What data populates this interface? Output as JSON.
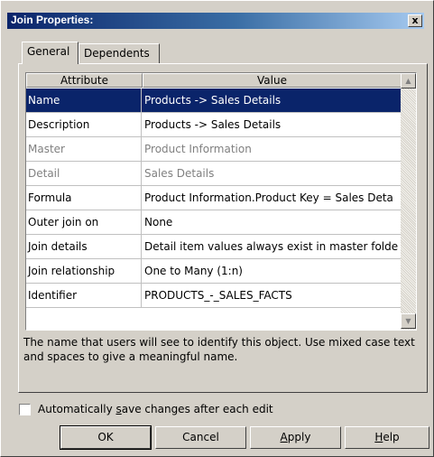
{
  "dialog": {
    "title": "Join Properties:",
    "close_glyph": "x"
  },
  "tabs": [
    {
      "label": "General",
      "active": true
    },
    {
      "label": "Dependents",
      "active": false
    }
  ],
  "grid": {
    "columns": [
      "Attribute",
      "Value"
    ],
    "rows": [
      {
        "attribute": "Name",
        "value": "Products -> Sales Details",
        "state": "selected"
      },
      {
        "attribute": "Description",
        "value": "Products -> Sales Details",
        "state": "normal"
      },
      {
        "attribute": "Master",
        "value": "Product Information",
        "state": "disabled"
      },
      {
        "attribute": "Detail",
        "value": "Sales Details",
        "state": "disabled"
      },
      {
        "attribute": "Formula",
        "value": "Product Information.Product Key = Sales Deta",
        "state": "normal"
      },
      {
        "attribute": "Outer join on",
        "value": "None",
        "state": "normal"
      },
      {
        "attribute": "Join details",
        "value": "Detail item values always exist in master folde",
        "state": "normal"
      },
      {
        "attribute": "Join relationship",
        "value": "One to Many (1:n)",
        "state": "normal"
      },
      {
        "attribute": "Identifier",
        "value": "PRODUCTS_-_SALES_FACTS",
        "state": "normal"
      }
    ],
    "scroll_up_icon": "triangle-up",
    "scroll_down_icon": "triangle-down"
  },
  "description": "The name that users will see to identify this object. Use mixed case text and spaces to give a meaningful name.",
  "auto_save": {
    "checked": false,
    "label_before": "Automatically ",
    "label_mnemonic": "s",
    "label_after": "ave changes after each edit"
  },
  "buttons": {
    "ok": "OK",
    "cancel": "Cancel",
    "apply_mnemonic": "A",
    "apply_rest": "pply",
    "help_mnemonic": "H",
    "help_rest": "elp"
  },
  "colors": {
    "dialog_bg": "#d4d0c8",
    "selection": "#0a246a",
    "title_gradient_start": "#0a246a",
    "disabled_text": "#808080"
  }
}
